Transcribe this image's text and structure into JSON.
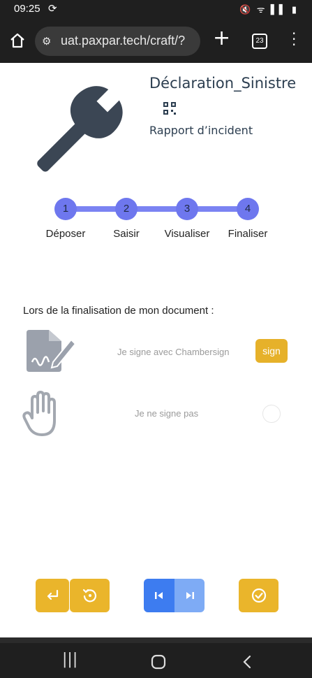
{
  "status_bar": {
    "time": "09:25",
    "icons_text": "🔇 ᯤ ▌▌ ▮"
  },
  "browser": {
    "url": "uat.paxpar.tech/craft/?",
    "tab_count": "23"
  },
  "header": {
    "title": "Déclaration_Sinistre",
    "subtitle": "Rapport d’incident"
  },
  "stepper": {
    "steps": [
      {
        "number": "1",
        "label": "Déposer"
      },
      {
        "number": "2",
        "label": "Saisir"
      },
      {
        "number": "3",
        "label": "Visualiser"
      },
      {
        "number": "4",
        "label": "Finaliser"
      }
    ]
  },
  "finalize": {
    "prompt": "Lors de la finalisation de mon document :",
    "sign_option": "Je signe avec Chambersign",
    "sign_button": "sign",
    "nosign_option": "Je ne signe pas"
  },
  "colors": {
    "accent": "#eab52b",
    "step": "#6e77ee",
    "primary_blue": "#3d7cf0"
  },
  "icons": [
    "home-icon",
    "tune-icon",
    "plus-icon",
    "tabs-icon",
    "more-icon",
    "wrench-icon",
    "qr-icon",
    "sign-document-icon",
    "hand-icon",
    "return-icon",
    "reset-icon",
    "first-page-icon",
    "last-page-icon",
    "check-circle-icon",
    "recent-apps-icon",
    "home-nav-icon",
    "back-nav-icon"
  ]
}
